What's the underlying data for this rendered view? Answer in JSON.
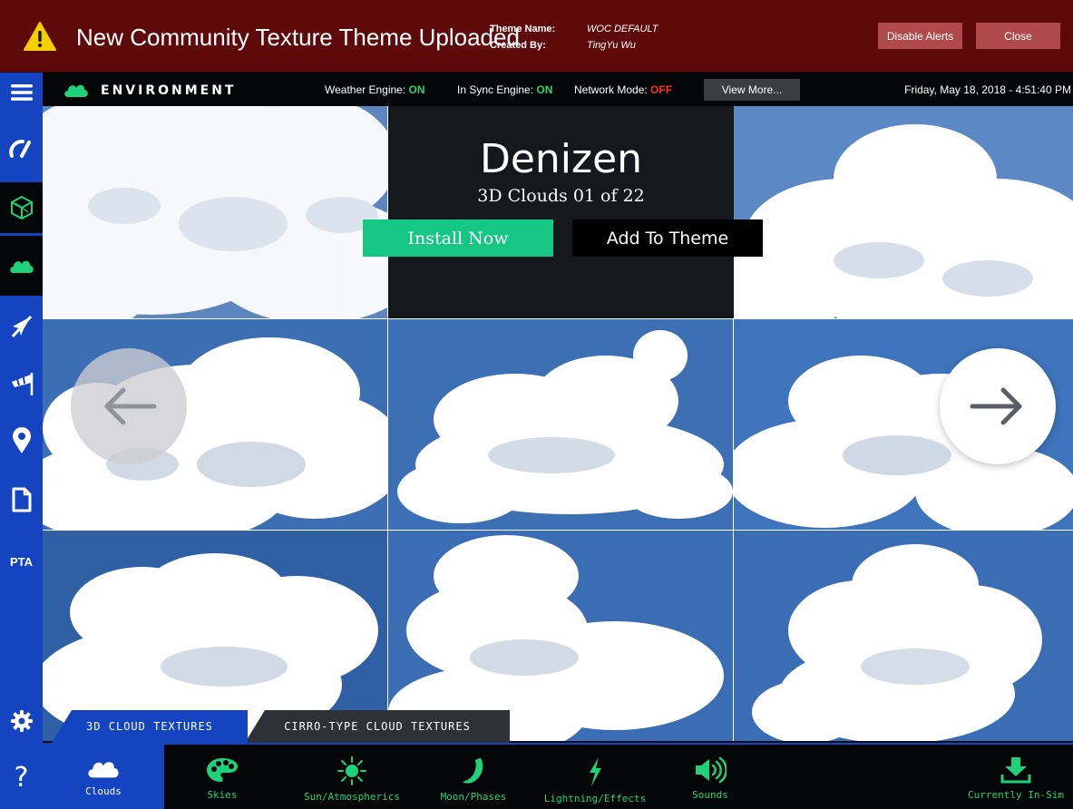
{
  "alert": {
    "title": "New Community Texture Theme Uploaded",
    "theme_name_label": "Theme Name:",
    "theme_name_value": "WOC DEFAULT",
    "created_by_label": "Created By:",
    "created_by_value": "TingYu Wu",
    "disable_label": "Disable Alerts",
    "close_label": "Close",
    "icon": "warning-icon"
  },
  "header": {
    "brand": "ENVIRONMENT",
    "weather_label": "Weather Engine:",
    "weather_value": "ON",
    "sync_label": "In Sync Engine:",
    "sync_value": "ON",
    "network_label": "Network Mode:",
    "network_value": "OFF",
    "view_more": "View More...",
    "datetime": "Friday, May 18, 2018 - 4:51:40 PM"
  },
  "sidebar": {
    "items": [
      {
        "icon": "menu-icon"
      },
      {
        "icon": "gauge-icon"
      },
      {
        "icon": "cube-icon"
      },
      {
        "icon": "cloud-icon",
        "active": true
      },
      {
        "icon": "airplane-icon"
      },
      {
        "icon": "windsock-icon"
      },
      {
        "icon": "location-pin-icon"
      },
      {
        "icon": "document-icon"
      },
      {
        "label": "PTA"
      },
      {
        "icon": "gear-icon"
      },
      {
        "label": "?"
      }
    ]
  },
  "feature": {
    "title": "Denizen",
    "subtitle": "3D Clouds 01 of 22",
    "install": "Install Now",
    "add_to_theme": "Add To Theme"
  },
  "category_tabs": [
    {
      "label": "3D CLOUD TEXTURES",
      "active": true
    },
    {
      "label": "CIRRO-TYPE CLOUD TEXTURES",
      "active": false
    }
  ],
  "bottom_nav": [
    {
      "label": "Clouds",
      "icon": "cloud-icon",
      "active": true
    },
    {
      "label": "Skies",
      "icon": "palette-icon"
    },
    {
      "label": "Sun/Atmospherics",
      "icon": "sun-icon"
    },
    {
      "label": "Moon/Phases",
      "icon": "moon-icon"
    },
    {
      "label": "Lightning/Effects",
      "icon": "lightning-icon"
    },
    {
      "label": "Sounds",
      "icon": "speaker-icon"
    },
    {
      "label": "Currently In-Sim",
      "icon": "download-icon"
    }
  ],
  "colors": {
    "alert_bg": "#5e0a0a",
    "accent_blue": "#1544c0",
    "accent_green": "#1fd27a",
    "install_green": "#16c784",
    "status_on": "#33d16b",
    "status_off": "#ff2a2a"
  }
}
